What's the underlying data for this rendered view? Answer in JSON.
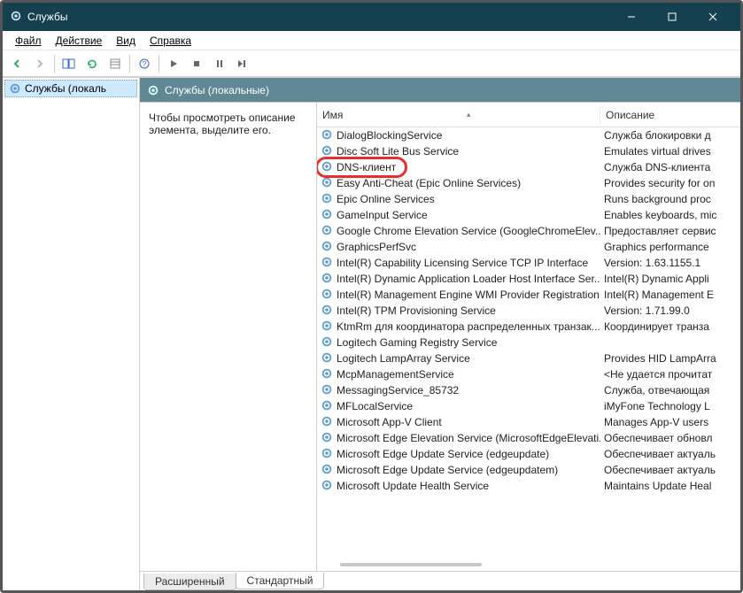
{
  "window": {
    "title": "Службы"
  },
  "menu": {
    "file": "Файл",
    "action": "Действие",
    "view": "Вид",
    "help": "Справка"
  },
  "tree": {
    "root": "Службы (локаль"
  },
  "panel": {
    "header": "Службы (локальные)"
  },
  "desc": {
    "text": "Чтобы просмотреть описание элемента, выделите его."
  },
  "columns": {
    "name": "Имя",
    "desc": "Описание"
  },
  "services": [
    {
      "name": "DialogBlockingService",
      "desc": "Служба блокировки д"
    },
    {
      "name": "Disc Soft Lite Bus Service",
      "desc": "Emulates virtual drives"
    },
    {
      "name": "DNS-клиент",
      "desc": "Служба DNS-клиента"
    },
    {
      "name": "Easy Anti-Cheat (Epic Online Services)",
      "desc": "Provides security for on"
    },
    {
      "name": "Epic Online Services",
      "desc": "Runs background proc"
    },
    {
      "name": "GameInput Service",
      "desc": "Enables keyboards, mic"
    },
    {
      "name": "Google Chrome Elevation Service (GoogleChromeElev...",
      "desc": "Предоставляет сервис"
    },
    {
      "name": "GraphicsPerfSvc",
      "desc": "Graphics performance"
    },
    {
      "name": "Intel(R) Capability Licensing Service TCP IP Interface",
      "desc": "Version: 1.63.1155.1"
    },
    {
      "name": "Intel(R) Dynamic Application Loader Host Interface Ser...",
      "desc": "Intel(R) Dynamic Appli"
    },
    {
      "name": "Intel(R) Management Engine WMI Provider Registration",
      "desc": "Intel(R) Management E"
    },
    {
      "name": "Intel(R) TPM Provisioning Service",
      "desc": "Version: 1.71.99.0"
    },
    {
      "name": "KtmRm для координатора распределенных транзак...",
      "desc": "Координирует транза"
    },
    {
      "name": "Logitech Gaming Registry Service",
      "desc": ""
    },
    {
      "name": "Logitech LampArray Service",
      "desc": "Provides HID LampArra"
    },
    {
      "name": "McpManagementService",
      "desc": "<Не удается прочитат"
    },
    {
      "name": "MessagingService_85732",
      "desc": "Служба, отвечающая"
    },
    {
      "name": "MFLocalService",
      "desc": "iMyFone Technology L"
    },
    {
      "name": "Microsoft App-V Client",
      "desc": "Manages App-V users"
    },
    {
      "name": "Microsoft Edge Elevation Service (MicrosoftEdgeElevati...",
      "desc": "Обеспечивает обновл"
    },
    {
      "name": "Microsoft Edge Update Service (edgeupdate)",
      "desc": "Обеспечивает актуаль"
    },
    {
      "name": "Microsoft Edge Update Service (edgeupdatem)",
      "desc": "Обеспечивает актуаль"
    },
    {
      "name": "Microsoft Update Health Service",
      "desc": "Maintains Update Heal"
    }
  ],
  "tabs": {
    "extended": "Расширенный",
    "standard": "Стандартный"
  }
}
